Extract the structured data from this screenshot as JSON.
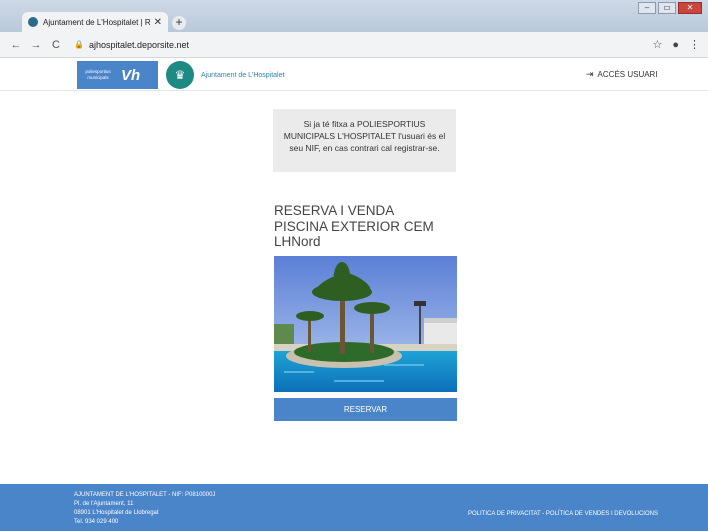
{
  "browser": {
    "tab_title": "Ajuntament de L'Hospitalet | Re:",
    "tab_close": "✕",
    "new_tab": "+",
    "url": "ajhospitalet.deporsite.net",
    "window_buttons": [
      "–",
      "▭",
      "✕"
    ]
  },
  "header": {
    "ps_logo_text": "poliesportius municipals",
    "ps_logo_mark": "Vh",
    "city_name": "Ajuntament de L'Hospitalet",
    "login_label": "ACCÉS USUARI"
  },
  "info": {
    "text": "Si ja té fitxa a POLIESPORTIUS MUNICIPALS L'HOSPITALET l'usuari és el seu NIF, en cas contrari cal registrar-se."
  },
  "card": {
    "title_line1": "RESERVA I VENDA",
    "title_line2": "PISCINA EXTERIOR CEM",
    "title_line3": "LHNord",
    "button_label": "RESERVAR"
  },
  "footer": {
    "line1": "AJUNTAMENT DE L'HOSPITALET - NIF: P0810000J",
    "line2": "Pl. de l'Ajuntament, 11",
    "line3": "08901 L'Hospitalet de Llobregat",
    "line4": "Tel. 934 029 400",
    "privacy": "POLITICA DE PRIVACITAT",
    "separator": " - ",
    "sales": "POLÍTICA DE VENDES I DEVOLUCIONS"
  },
  "colors": {
    "brand_blue": "#4a84c9",
    "city_teal": "#1f8a84"
  },
  "icons": [
    "back-arrow-icon",
    "forward-arrow-icon",
    "reload-icon",
    "lock-icon",
    "star-icon",
    "account-icon",
    "menu-dots-icon",
    "login-icon",
    "city-crest-icon"
  ]
}
